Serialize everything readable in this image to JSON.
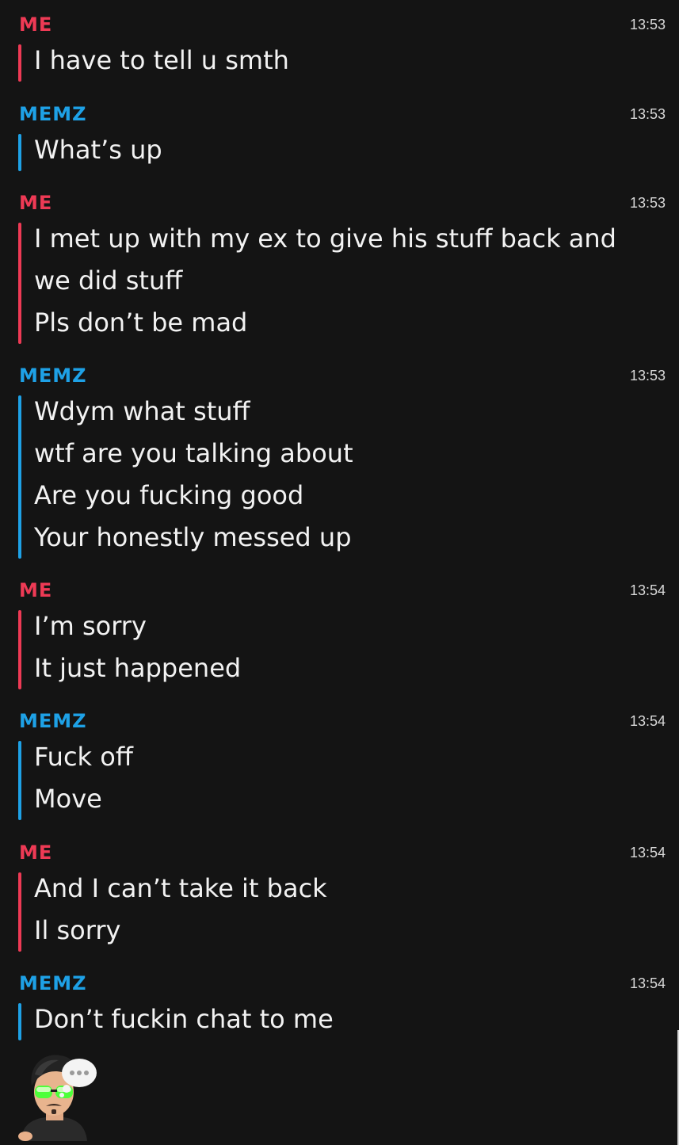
{
  "colors": {
    "background": "#141414",
    "me": "#ee3a55",
    "them": "#1ea1e6",
    "text": "#f2f2f2",
    "time": "#d9d9d9"
  },
  "messages": [
    {
      "sender": "ME",
      "side": "me",
      "time": "13:53",
      "lines": [
        "I have to tell u smth"
      ]
    },
    {
      "sender": "MEMZ",
      "side": "them",
      "time": "13:53",
      "lines": [
        "What’s up"
      ]
    },
    {
      "sender": "ME",
      "side": "me",
      "time": "13:53",
      "lines": [
        "I met up with my ex to give his stuff back and",
        "we did stuff",
        "Pls don’t be mad"
      ]
    },
    {
      "sender": "MEMZ",
      "side": "them",
      "time": "13:53",
      "lines": [
        "Wdym what stuff",
        "wtf are you talking about",
        "Are you fucking good",
        "Your honestly messed up"
      ]
    },
    {
      "sender": "ME",
      "side": "me",
      "time": "13:54",
      "lines": [
        "I’m sorry",
        "It just happened"
      ]
    },
    {
      "sender": "MEMZ",
      "side": "them",
      "time": "13:54",
      "lines": [
        "Fuck off",
        "Move"
      ]
    },
    {
      "sender": "ME",
      "side": "me",
      "time": "13:54",
      "lines": [
        "And I can’t take it back",
        "Il sorry"
      ]
    },
    {
      "sender": "MEMZ",
      "side": "them",
      "time": "13:54",
      "lines": [
        "Don’t fuckin chat to me"
      ]
    }
  ],
  "typing_indicator": {
    "icon": "bitmoji-avatar-typing-icon"
  }
}
